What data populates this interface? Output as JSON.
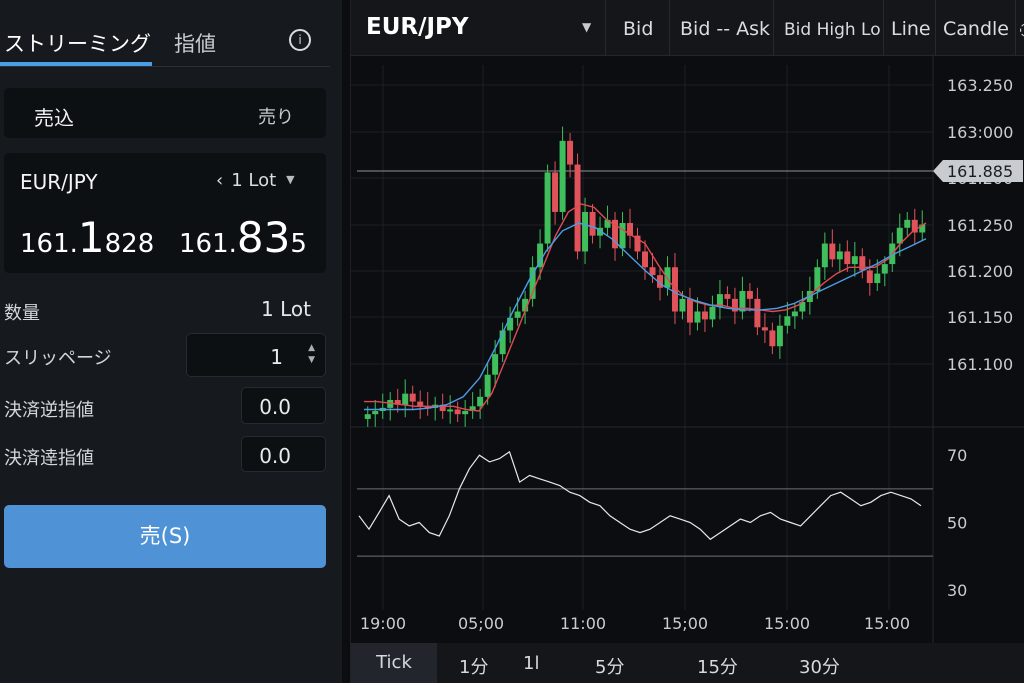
{
  "left_panel": {
    "tabs": [
      "ストリーミング",
      "指値"
    ],
    "info_icon": "info-icon",
    "side_selector": {
      "left_label": "売込",
      "right_label": "売り"
    },
    "quote": {
      "pair": "EUR/JPY",
      "lot": "1 Lot",
      "bid": {
        "prefix": "161.",
        "big": "1",
        "suffix": "828"
      },
      "ask": {
        "prefix": "161.",
        "big": "83",
        "suffix": "5"
      }
    },
    "rows": {
      "quantity_label": "数量",
      "quantity_value": "1 Lot",
      "slippage_label": "スリッページ",
      "slippage_value": "1",
      "stop_label": "決済逆指値",
      "stop_value": "0.0",
      "limit_label": "決済逹指値",
      "limit_value": "0.0"
    },
    "sell_button": "売(S)",
    "colors": {
      "accent": "#4a9ee6",
      "sell_button": "#4f93d6"
    }
  },
  "toolbar": {
    "symbol": "EUR/JPY",
    "items": [
      "Bid",
      "Bid -- Ask",
      "Bid High Lo",
      "Line",
      "Candle"
    ]
  },
  "timeframes": [
    "Tick",
    "1分",
    "1l",
    "5分",
    "15分",
    "30分"
  ],
  "chart_data": [
    {
      "type": "candlestick",
      "y_ticks": [
        "163.250",
        "163:000",
        "161.200",
        "161.250",
        "161.200",
        "161.150",
        "161.100"
      ],
      "ylim": [
        161.07,
        163.38
      ],
      "x_ticks": [
        "19:00",
        "05;00",
        "11:00",
        "15;00",
        "15:00",
        "15:00"
      ],
      "current_price": "161.885",
      "current_price_value": 162.36,
      "closes": [
        161.17,
        161.19,
        161.21,
        161.26,
        161.23,
        161.3,
        161.25,
        161.22,
        161.21,
        161.23,
        161.19,
        161.2,
        161.17,
        161.19,
        161.22,
        161.28,
        161.42,
        161.55,
        161.7,
        161.78,
        161.82,
        161.9,
        162.1,
        162.25,
        162.7,
        162.45,
        162.9,
        162.75,
        162.2,
        162.45,
        162.3,
        162.35,
        162.4,
        162.22,
        162.38,
        162.3,
        162.2,
        162.1,
        162.05,
        161.97,
        162.1,
        161.82,
        161.9,
        161.75,
        161.82,
        161.77,
        161.85,
        161.93,
        161.9,
        161.82,
        161.95,
        161.9,
        161.72,
        161.7,
        161.6,
        161.73,
        161.79,
        161.82,
        161.88,
        161.95,
        162.1,
        162.25,
        162.15,
        162.2,
        162.12,
        162.17,
        162.08,
        162.0,
        162.06,
        162.12,
        162.25,
        162.35,
        162.4,
        162.32,
        162.37
      ],
      "ma_fast": [
        161.25,
        161.25,
        161.24,
        161.23,
        161.22,
        161.22,
        161.22,
        161.22,
        161.2,
        161.19,
        161.3,
        161.5,
        161.7,
        161.9,
        162.1,
        162.3,
        162.45,
        162.5,
        162.48,
        162.4,
        162.35,
        162.3,
        162.25,
        162.12,
        162.0,
        161.92,
        161.88,
        161.86,
        161.86,
        161.84,
        161.84,
        161.83,
        161.82,
        161.83,
        161.86,
        161.93,
        162.0,
        162.06,
        162.1,
        162.1,
        162.1,
        162.15,
        162.25,
        162.33,
        162.38
      ],
      "ma_slow": [
        161.2,
        161.2,
        161.2,
        161.2,
        161.21,
        161.23,
        161.28,
        161.4,
        161.6,
        161.82,
        162.02,
        162.2,
        162.33,
        162.38,
        162.35,
        162.28,
        162.18,
        162.08,
        161.99,
        161.93,
        161.89,
        161.86,
        161.84,
        161.83,
        161.83,
        161.84,
        161.87,
        161.92,
        161.97,
        162.02,
        162.07,
        162.12,
        162.18,
        162.23,
        162.28
      ]
    },
    {
      "type": "line",
      "name": "",
      "y_ticks": [
        "70",
        "50",
        "30"
      ],
      "ylim": [
        24,
        76
      ],
      "levels": [
        60,
        40
      ],
      "values": [
        52,
        48,
        53,
        58,
        51,
        49,
        50,
        47,
        46,
        52,
        60,
        66,
        70,
        68,
        69,
        71,
        62,
        64,
        63,
        62,
        61,
        59,
        58,
        56,
        55,
        52,
        50,
        48,
        47,
        48,
        50,
        52,
        51,
        50,
        48,
        45,
        47,
        49,
        51,
        50,
        52,
        53,
        51,
        50,
        49,
        52,
        55,
        58,
        59,
        57,
        55,
        56,
        58,
        59,
        58,
        57,
        55
      ]
    }
  ]
}
